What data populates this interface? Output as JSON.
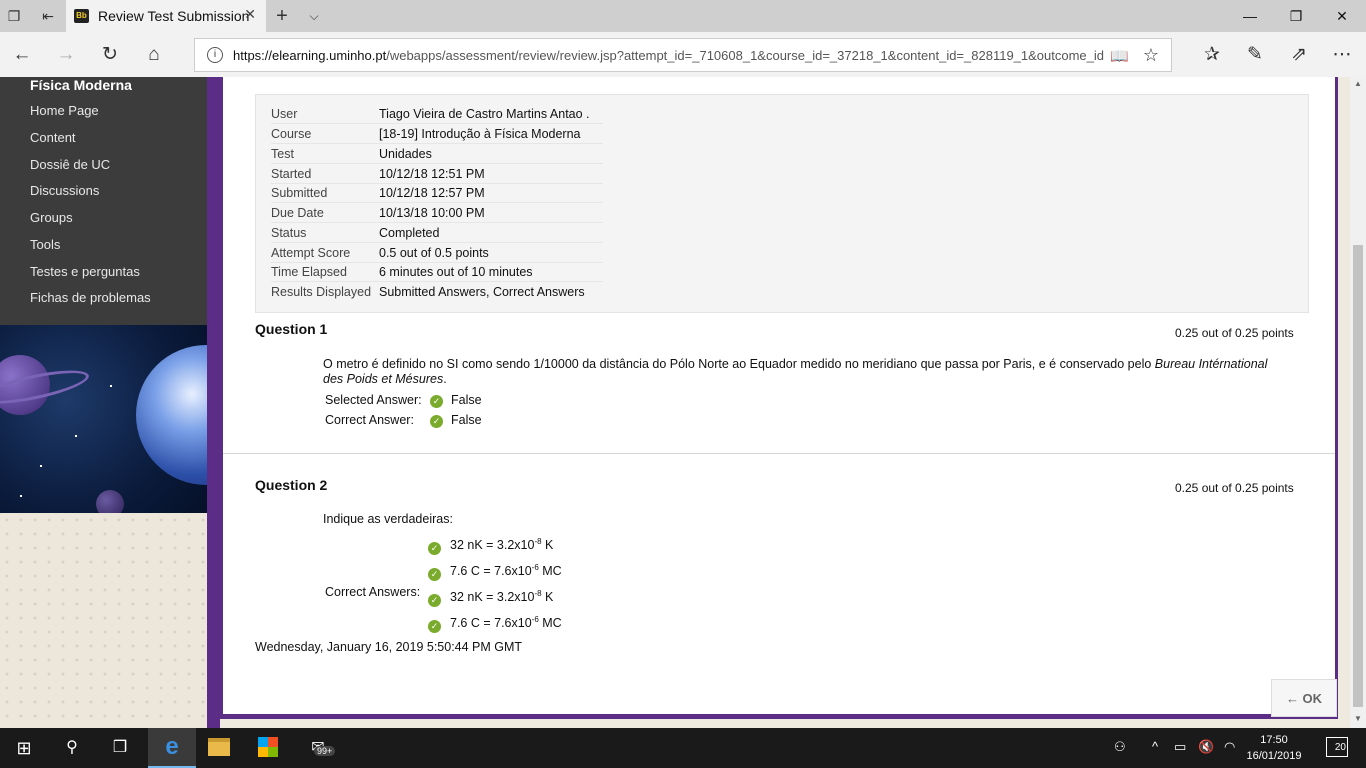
{
  "browser": {
    "tab_title": "Review Test Submission",
    "tab_logo": "Bb",
    "url_domain": "https://elearning.uminho.pt",
    "url_path": "/webapps/assessment/review/review.jsp?attempt_id=_710608_1&course_id=_37218_1&content_id=_828119_1&outcome_id"
  },
  "sidebar": {
    "title": "Física Moderna",
    "items": [
      {
        "label": "Home Page"
      },
      {
        "label": "Content"
      },
      {
        "label": "Dossiê de UC"
      },
      {
        "label": "Discussions"
      },
      {
        "label": "Groups"
      },
      {
        "label": "Tools"
      },
      {
        "label": "Testes e perguntas"
      },
      {
        "label": "Fichas de problemas"
      }
    ]
  },
  "summary": [
    {
      "label": "User",
      "value": "Tiago Vieira de Castro Martins Antao ."
    },
    {
      "label": "Course",
      "value": "[18-19] Introdução à Física Moderna"
    },
    {
      "label": "Test",
      "value": "Unidades"
    },
    {
      "label": "Started",
      "value": "10/12/18 12:51 PM"
    },
    {
      "label": "Submitted",
      "value": "10/12/18 12:57 PM"
    },
    {
      "label": "Due Date",
      "value": "10/13/18 10:00 PM"
    },
    {
      "label": "Status",
      "value": "Completed"
    },
    {
      "label": "Attempt Score",
      "value": "0.5 out of 0.5 points"
    },
    {
      "label": "Time Elapsed",
      "value": "6 minutes out of 10 minutes"
    },
    {
      "label": "Results Displayed",
      "value": "Submitted Answers, Correct Answers"
    }
  ],
  "q1": {
    "title": "Question 1",
    "points": "0.25 out of 0.25 points",
    "text": "O metro é definido no SI como sendo 1/10000 da distância do Pólo Norte ao Equador medido no meridiano que passa por Paris, e é conservado pelo",
    "text_italic": "Bureau Intérnational des Poids et Mésures",
    "text_end": ".",
    "selected_label": "Selected Answer:",
    "selected_value": "False",
    "correct_label": "Correct Answer:",
    "correct_value": "False"
  },
  "q2": {
    "title": "Question 2",
    "points": "0.25 out of 0.25 points",
    "text": "Indique as verdadeiras:",
    "correct_label": "Correct Answers:",
    "answers": [
      {
        "pre": "32 nK = 3.2x10",
        "exp": "-8",
        "post": " K"
      },
      {
        "pre": "7.6 C = 7.6x10",
        "exp": "-6",
        "post": " MC"
      },
      {
        "pre": "32 nK = 3.2x10",
        "exp": "-8",
        "post": " K"
      },
      {
        "pre": "7.6 C = 7.6x10",
        "exp": "-6",
        "post": " MC"
      }
    ]
  },
  "footer_date": "Wednesday, January 16, 2019 5:50:44 PM GMT",
  "ok_button": "← OK",
  "taskbar": {
    "time": "17:50",
    "date": "16/01/2019",
    "badge": "99+",
    "notifications": "20"
  },
  "icons": [
    "tabs-icon",
    "back-tabs-icon",
    "new-tab-icon",
    "tab-list-icon",
    "minimize-icon",
    "restore-icon",
    "close-icon",
    "back-icon",
    "forward-icon",
    "refresh-icon",
    "home-icon",
    "info-icon",
    "reading-view-icon",
    "favorite-star-icon",
    "favorites-icon",
    "pen-icon",
    "share-icon",
    "more-icon",
    "check-icon",
    "windows-start-icon",
    "search-icon",
    "task-view-icon",
    "edge-icon",
    "folder-icon",
    "store-icon",
    "network-icon",
    "battery-icon",
    "volume-icon",
    "wifi-icon",
    "notification-icon"
  ],
  "colors": {
    "accent_purple": "#5b2d86",
    "sidebar_bg": "#3c3c3c",
    "check_green": "#7aab2c"
  }
}
